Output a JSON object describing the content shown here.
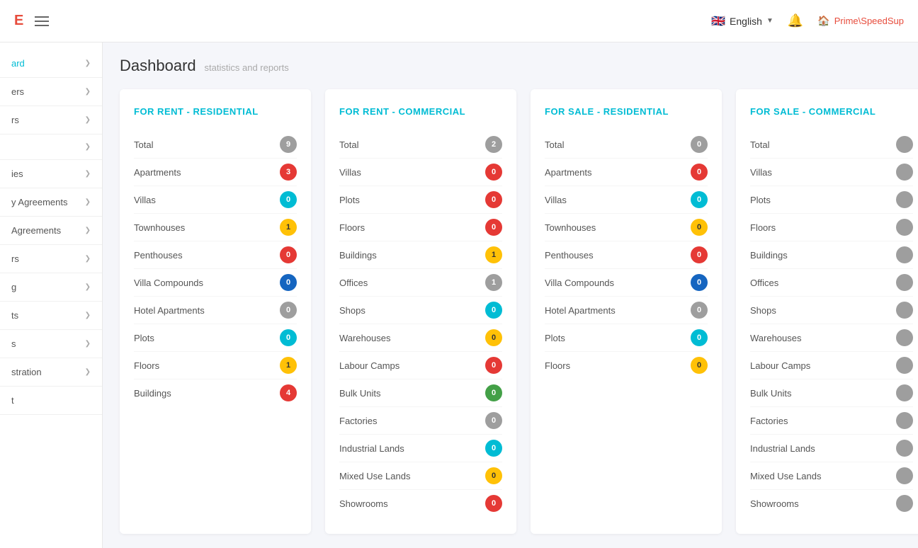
{
  "header": {
    "logo": "E",
    "hamburger_label": "menu",
    "lang": "English",
    "bell_label": "notifications",
    "user": "Prime\\SpeedSup"
  },
  "sidebar": {
    "items": [
      {
        "label": "ard",
        "active": true
      },
      {
        "label": "ers"
      },
      {
        "label": "rs"
      },
      {
        "label": ""
      },
      {
        "label": "ies"
      },
      {
        "label": "y Agreements"
      },
      {
        "label": "Agreements"
      },
      {
        "label": "rs"
      },
      {
        "label": "g"
      },
      {
        "label": "ts"
      },
      {
        "label": "s"
      },
      {
        "label": "stration"
      },
      {
        "label": "t"
      }
    ]
  },
  "page": {
    "title": "Dashboard",
    "subtitle": "statistics and reports"
  },
  "cards": [
    {
      "id": "for-rent-residential",
      "title": "FOR RENT - RESIDENTIAL",
      "rows": [
        {
          "label": "Total",
          "value": "9",
          "color": "gray"
        },
        {
          "label": "Apartments",
          "value": "3",
          "color": "red"
        },
        {
          "label": "Villas",
          "value": "0",
          "color": "teal"
        },
        {
          "label": "Townhouses",
          "value": "1",
          "color": "yellow"
        },
        {
          "label": "Penthouses",
          "value": "0",
          "color": "red"
        },
        {
          "label": "Villa Compounds",
          "value": "0",
          "color": "blue"
        },
        {
          "label": "Hotel Apartments",
          "value": "0",
          "color": "gray"
        },
        {
          "label": "Plots",
          "value": "0",
          "color": "teal"
        },
        {
          "label": "Floors",
          "value": "1",
          "color": "yellow"
        },
        {
          "label": "Buildings",
          "value": "4",
          "color": "red"
        }
      ]
    },
    {
      "id": "for-rent-commercial",
      "title": "FOR RENT - COMMERCIAL",
      "rows": [
        {
          "label": "Total",
          "value": "2",
          "color": "gray"
        },
        {
          "label": "Villas",
          "value": "0",
          "color": "red"
        },
        {
          "label": "Plots",
          "value": "0",
          "color": "red"
        },
        {
          "label": "Floors",
          "value": "0",
          "color": "red"
        },
        {
          "label": "Buildings",
          "value": "1",
          "color": "yellow"
        },
        {
          "label": "Offices",
          "value": "1",
          "color": "gray"
        },
        {
          "label": "Shops",
          "value": "0",
          "color": "teal"
        },
        {
          "label": "Warehouses",
          "value": "0",
          "color": "yellow"
        },
        {
          "label": "Labour Camps",
          "value": "0",
          "color": "red"
        },
        {
          "label": "Bulk Units",
          "value": "0",
          "color": "green"
        },
        {
          "label": "Factories",
          "value": "0",
          "color": "gray"
        },
        {
          "label": "Industrial Lands",
          "value": "0",
          "color": "teal"
        },
        {
          "label": "Mixed Use Lands",
          "value": "0",
          "color": "yellow"
        },
        {
          "label": "Showrooms",
          "value": "0",
          "color": "red"
        }
      ]
    },
    {
      "id": "for-sale-residential",
      "title": "FOR SALE - RESIDENTIAL",
      "rows": [
        {
          "label": "Total",
          "value": "0",
          "color": "gray"
        },
        {
          "label": "Apartments",
          "value": "0",
          "color": "red"
        },
        {
          "label": "Villas",
          "value": "0",
          "color": "teal"
        },
        {
          "label": "Townhouses",
          "value": "0",
          "color": "yellow"
        },
        {
          "label": "Penthouses",
          "value": "0",
          "color": "red"
        },
        {
          "label": "Villa Compounds",
          "value": "0",
          "color": "blue"
        },
        {
          "label": "Hotel Apartments",
          "value": "0",
          "color": "gray"
        },
        {
          "label": "Plots",
          "value": "0",
          "color": "teal"
        },
        {
          "label": "Floors",
          "value": "0",
          "color": "yellow"
        }
      ]
    },
    {
      "id": "for-sale-commercial",
      "title": "FOR SALE - COMMERCIAL",
      "rows": [
        {
          "label": "Total",
          "value": "",
          "color": "gray"
        },
        {
          "label": "Villas",
          "value": "",
          "color": "gray"
        },
        {
          "label": "Plots",
          "value": "",
          "color": "gray"
        },
        {
          "label": "Floors",
          "value": "",
          "color": "gray"
        },
        {
          "label": "Buildings",
          "value": "",
          "color": "gray"
        },
        {
          "label": "Offices",
          "value": "",
          "color": "gray"
        },
        {
          "label": "Shops",
          "value": "",
          "color": "gray"
        },
        {
          "label": "Warehouses",
          "value": "",
          "color": "gray"
        },
        {
          "label": "Labour Camps",
          "value": "",
          "color": "gray"
        },
        {
          "label": "Bulk Units",
          "value": "",
          "color": "gray"
        },
        {
          "label": "Factories",
          "value": "",
          "color": "gray"
        },
        {
          "label": "Industrial Lands",
          "value": "",
          "color": "gray"
        },
        {
          "label": "Mixed Use Lands",
          "value": "",
          "color": "gray"
        },
        {
          "label": "Showrooms",
          "value": "",
          "color": "gray"
        }
      ]
    }
  ]
}
